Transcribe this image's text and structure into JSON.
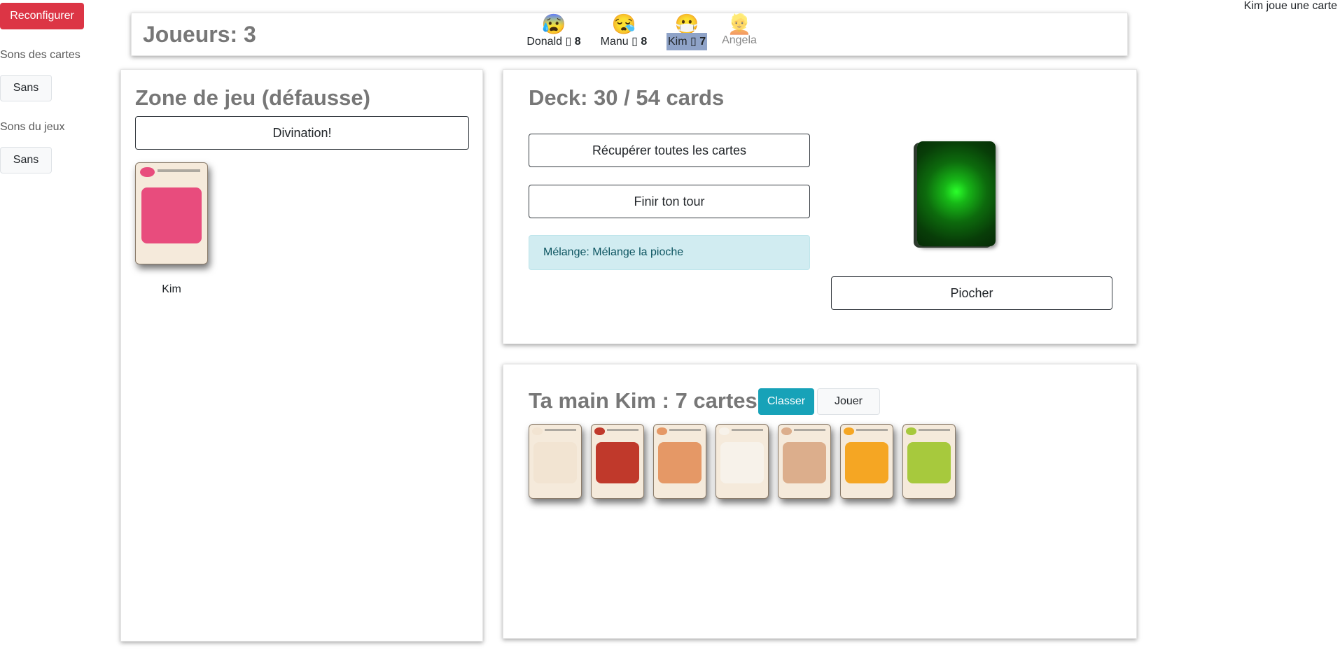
{
  "sidebar": {
    "reconfigure_label": "Reconfigurer",
    "card_sounds_label": "Sons des cartes",
    "card_sounds_value": "Sans",
    "game_sounds_label": "Sons du jeux",
    "game_sounds_value": "Sans"
  },
  "status_message": "Kim joue une carte",
  "header": {
    "players_title": "Joueurs: 3",
    "players": [
      {
        "name": "Donald",
        "face": "😰",
        "card_icon": "▯",
        "count": "8",
        "state": "normal"
      },
      {
        "name": "Manu",
        "face": "😪",
        "card_icon": "▯",
        "count": "8",
        "state": "normal"
      },
      {
        "name": "Kim",
        "face": "😷",
        "card_icon": "▯",
        "count": "7",
        "state": "active"
      },
      {
        "name": "Angela",
        "face": "👱",
        "card_icon": "",
        "count": "",
        "state": "out"
      }
    ]
  },
  "play_zone": {
    "title": "Zone de jeu (défausse)",
    "action_label": "Divination!",
    "discard_player": "Kim",
    "discard_card_color": "#e84c7d"
  },
  "deck": {
    "title": "Deck: 30 / 54 cards",
    "recover_label": "Récupérer toutes les cartes",
    "end_turn_label": "Finir ton tour",
    "info_message": "Mélange: Mélange la pioche",
    "draw_label": "Piocher",
    "back_color": "#17b617"
  },
  "hand": {
    "title": "Ta main Kim : 7 cartes",
    "sort_label": "Classer",
    "play_label": "Jouer",
    "cards": [
      {
        "name": "bearded-cat-card",
        "color": "#f2e4d2"
      },
      {
        "name": "nope-card",
        "color": "#c0392b"
      },
      {
        "name": "bat-card",
        "color": "#e59866"
      },
      {
        "name": "rainbow-cat-card",
        "color": "#f7f2ea"
      },
      {
        "name": "tacocat-card",
        "color": "#dcae8c"
      },
      {
        "name": "attack-card",
        "color": "#f5a623"
      },
      {
        "name": "skip-card",
        "color": "#a7c93d"
      }
    ]
  }
}
